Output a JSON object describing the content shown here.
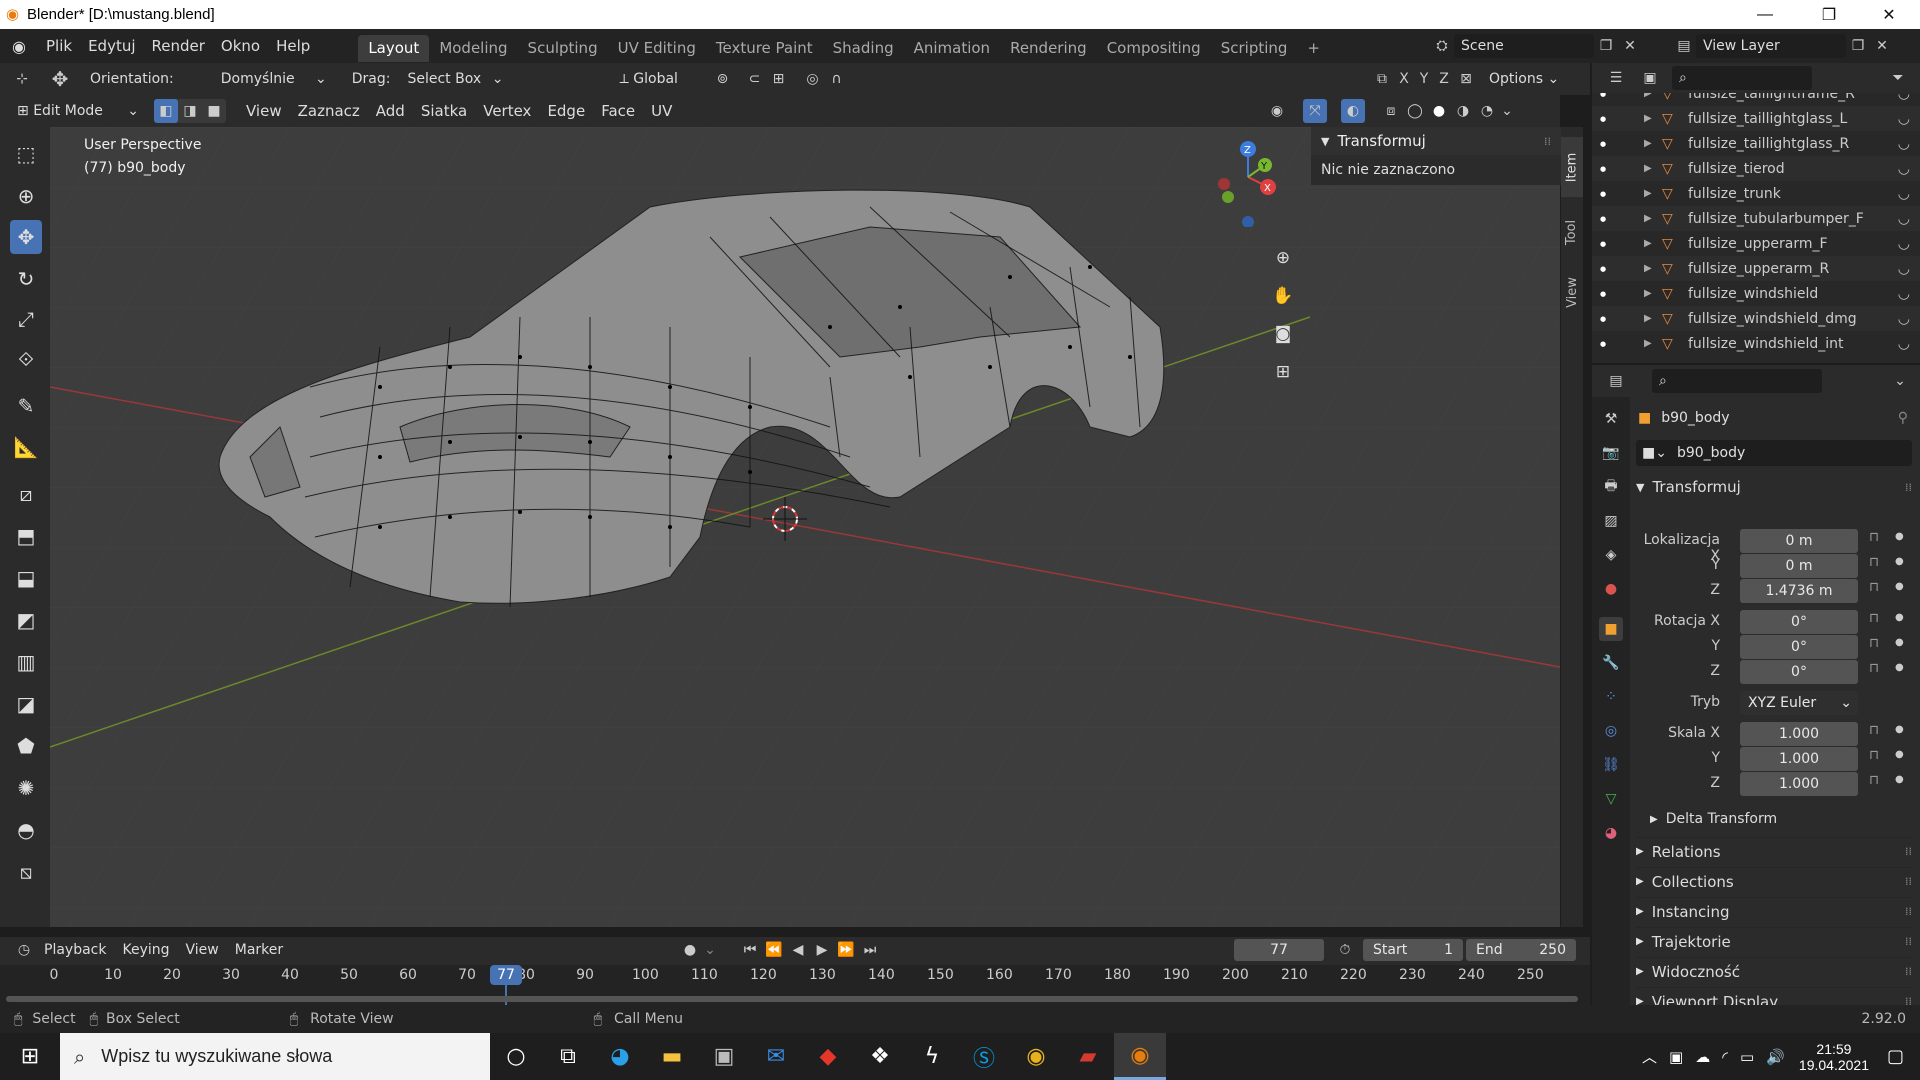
{
  "window": {
    "title": "Blender* [D:\\mustang.blend]",
    "minimize": "—",
    "maximize": "❐",
    "close": "✕"
  },
  "menu": [
    "Plik",
    "Edytuj",
    "Render",
    "Okno",
    "Help"
  ],
  "workspaces": [
    "Layout",
    "Modeling",
    "Sculpting",
    "UV Editing",
    "Texture Paint",
    "Shading",
    "Animation",
    "Rendering",
    "Compositing",
    "Scripting"
  ],
  "workspace_add": "+",
  "scene": {
    "name": "Scene",
    "view_layer": "View Layer"
  },
  "tool_header": {
    "orientation_label": "Orientation:",
    "orientation_value": "Domyślnie",
    "drag_label": "Drag:",
    "drag_value": "Select Box",
    "transform_orient": "Global",
    "options": "Options",
    "axes": [
      "X",
      "Y",
      "Z"
    ]
  },
  "viewport_header": {
    "mode": "Edit Mode",
    "menus": [
      "View",
      "Zaznacz",
      "Add",
      "Siatka",
      "Vertex",
      "Edge",
      "Face",
      "UV"
    ]
  },
  "viewport": {
    "perspective": "User Perspective",
    "object": "(77) b90_body",
    "gizmo": {
      "x": "X",
      "y": "Y",
      "z": "Z"
    }
  },
  "npanel": {
    "title": "Transformuj",
    "message": "Nic nie zaznaczono",
    "tabs": [
      "Item",
      "Tool",
      "View"
    ]
  },
  "outliner": {
    "items": [
      "fullsize_taillightframe_R",
      "fullsize_taillightglass_L",
      "fullsize_taillightglass_R",
      "fullsize_tierod",
      "fullsize_trunk",
      "fullsize_tubularbumper_F",
      "fullsize_upperarm_F",
      "fullsize_upperarm_R",
      "fullsize_windshield",
      "fullsize_windshield_dmg",
      "fullsize_windshield_int"
    ]
  },
  "properties": {
    "object_name": "b90_body",
    "object_field": "b90_body",
    "transform_title": "Transformuj",
    "location_label": "Lokalizacja X",
    "location": [
      "0 m",
      "0 m",
      "1.4736 m"
    ],
    "rotation_label": "Rotacja X",
    "rotation": [
      "0°",
      "0°",
      "0°"
    ],
    "mode_label": "Tryb",
    "mode_value": "XYZ Euler",
    "scale_label": "Skala X",
    "scale": [
      "1.000",
      "1.000",
      "1.000"
    ],
    "axis_y": "Y",
    "axis_z": "Z",
    "delta": "Delta Transform",
    "sections": [
      "Relations",
      "Collections",
      "Instancing",
      "Trajektorie",
      "Widoczność",
      "Viewport Display"
    ]
  },
  "timeline": {
    "menus": [
      "Playback",
      "Keying",
      "View",
      "Marker"
    ],
    "current_frame": "77",
    "start_label": "Start",
    "start": "1",
    "end_label": "End",
    "end": "250",
    "ticks": [
      "0",
      "10",
      "20",
      "30",
      "40",
      "50",
      "60",
      "70",
      "80",
      "90",
      "100",
      "110",
      "120",
      "130",
      "140",
      "150",
      "160",
      "170",
      "180",
      "190",
      "200",
      "210",
      "220",
      "230",
      "240",
      "250"
    ],
    "playhead": "77"
  },
  "status": {
    "select": "Select",
    "box_select": "Box Select",
    "rotate": "Rotate View",
    "call_menu": "Call Menu",
    "version": "2.92.0"
  },
  "taskbar": {
    "search_placeholder": "Wpisz tu wyszukiwane słowa",
    "time": "21:59",
    "date": "19.04.2021"
  }
}
